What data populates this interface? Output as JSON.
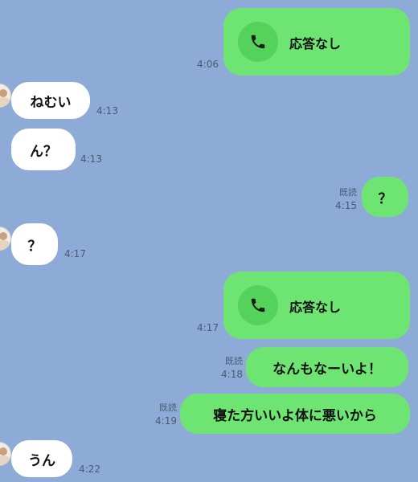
{
  "messages": [
    {
      "type": "call",
      "direction": "out",
      "label": "応答なし",
      "time": "4:06"
    },
    {
      "type": "text",
      "direction": "in",
      "text": "ねむい",
      "time": "4:13"
    },
    {
      "type": "text",
      "direction": "in",
      "text": "ん？",
      "time": "4:13"
    },
    {
      "type": "text",
      "direction": "out",
      "text": "？",
      "read": "既読",
      "time": "4:15"
    },
    {
      "type": "text",
      "direction": "in",
      "text": "？",
      "time": "4:17"
    },
    {
      "type": "call",
      "direction": "out",
      "label": "応答なし",
      "time": "4:17"
    },
    {
      "type": "text",
      "direction": "out",
      "text": "なんもなーいよ！",
      "read": "既読",
      "time": "4:18"
    },
    {
      "type": "text",
      "direction": "out",
      "text": "寝た方いいよ体に悪いから",
      "read": "既読",
      "time": "4:19"
    },
    {
      "type": "text",
      "direction": "in",
      "text": "うん",
      "time": "4:22"
    }
  ],
  "colors": {
    "background": "#8eabd8",
    "outgoing_bubble": "#6ee573",
    "incoming_bubble": "#ffffff",
    "call_icon_circle": "#55d25a"
  },
  "icons": {
    "call": "phone-icon",
    "avatar": "avatar"
  }
}
